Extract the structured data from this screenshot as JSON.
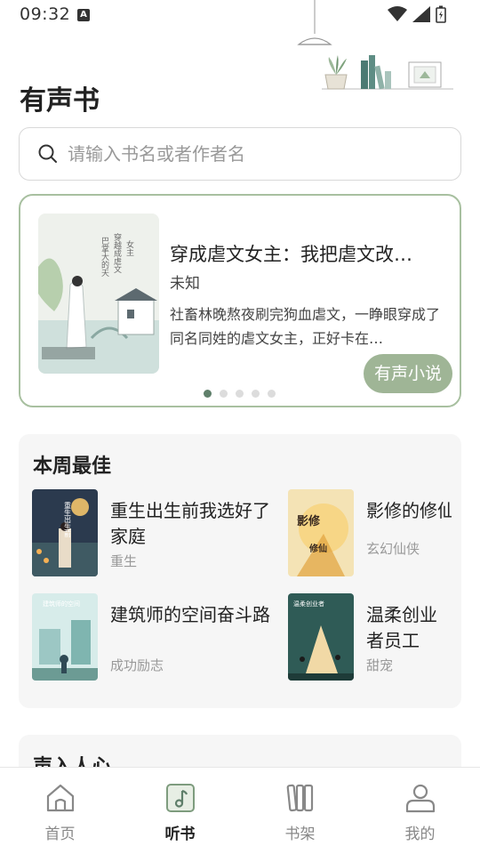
{
  "status_bar": {
    "time": "09:32",
    "notif_letter": "A"
  },
  "page_title": "有声书",
  "search": {
    "placeholder": "请输入书名或者作者名"
  },
  "banner": {
    "title": "穿成虐文女主：我把虐文改…",
    "author": "未知",
    "description": "社畜林晚熬夜刷完狗血虐文，一睁眼穿成了同名同姓的虐文女主，正好卡在…",
    "tag": "有声小说",
    "cover_text": "巴掌大的天，穿越成虐文女主",
    "dots_total": 5,
    "dots_active": 0
  },
  "weekly": {
    "title": "本周最佳",
    "books": [
      {
        "title": "重生出生前我选好了家庭",
        "genre": "重生",
        "cover_text": "重生出生前我选好了家庭"
      },
      {
        "title": "影修的修仙",
        "genre": "玄幻仙侠",
        "cover_text": "影修的修仙秘诀"
      },
      {
        "title": "建筑师的空间奋斗路",
        "genre": "成功励志",
        "cover_text": "建筑师的空间奋斗路"
      },
      {
        "title": "温柔创业者员工",
        "genre": "甜宠",
        "cover_text": "温柔创业者员工"
      }
    ]
  },
  "next_section": {
    "title": "声入人心"
  },
  "nav": {
    "items": [
      {
        "label": "首页",
        "icon": "home-icon",
        "active": false
      },
      {
        "label": "听书",
        "icon": "music-note-icon",
        "active": true
      },
      {
        "label": "书架",
        "icon": "bookshelf-icon",
        "active": false
      },
      {
        "label": "我的",
        "icon": "user-icon",
        "active": false
      }
    ]
  },
  "colors": {
    "accent": "#9fb596",
    "banner_border": "#a8c0a0",
    "dot_active": "#5f7f6a"
  }
}
